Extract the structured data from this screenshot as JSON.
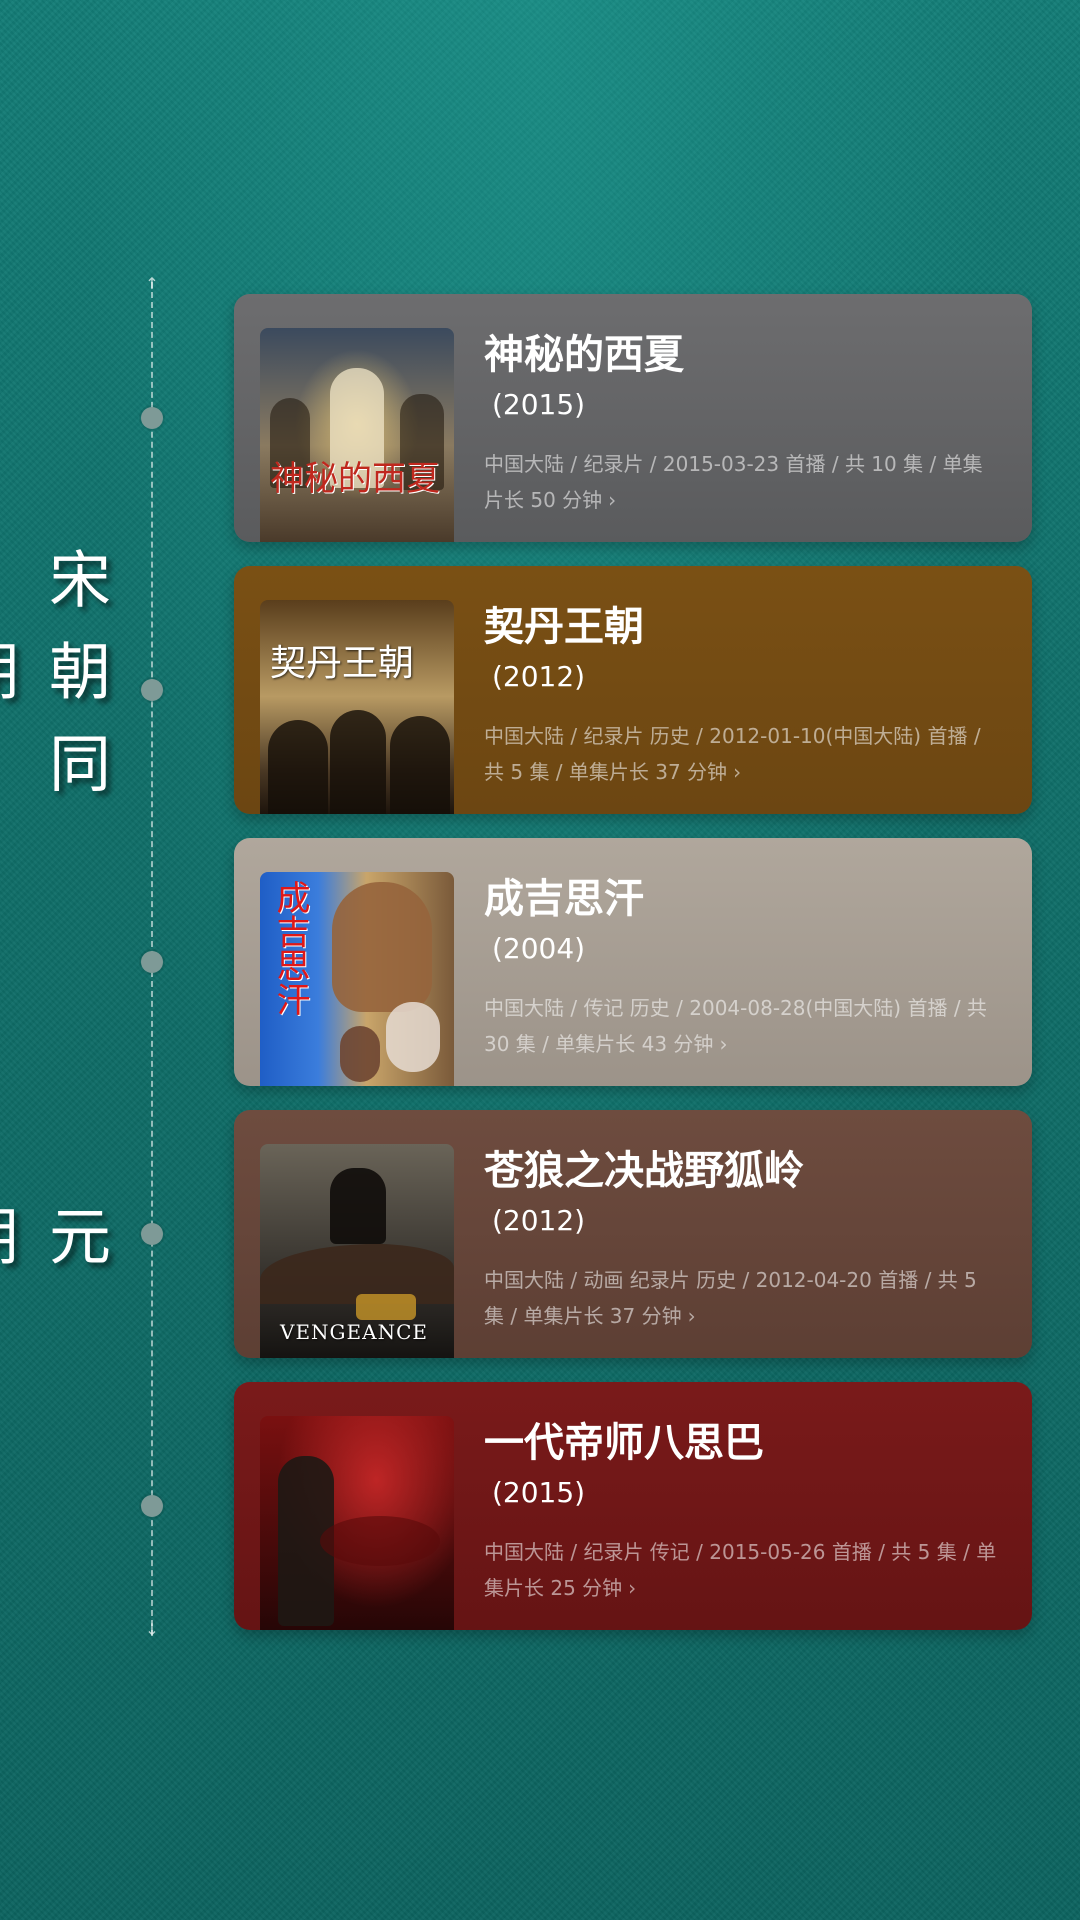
{
  "eras": [
    {
      "label": "宋朝同期"
    },
    {
      "label": "元朝"
    }
  ],
  "cards": [
    {
      "title": "神秘的西夏",
      "year": "(2015)",
      "meta": "中国大陆 / 纪录片 / 2015-03-23 首播 / 共 10 集 / 单集片长 50 分钟",
      "poster_text": "神秘的西夏",
      "chevron": "›"
    },
    {
      "title": "契丹王朝",
      "year": "(2012)",
      "meta": "中国大陆 / 纪录片 历史 / 2012-01-10(中国大陆) 首播 / 共 5 集 / 单集片长 37 分钟",
      "poster_text": "契丹王朝",
      "chevron": "›"
    },
    {
      "title": "成吉思汗",
      "year": "(2004)",
      "meta": "中国大陆 / 传记 历史 / 2004-08-28(中国大陆) 首播 / 共 30 集 / 单集片长 43 分钟",
      "poster_text": "成吉思汗",
      "chevron": "›"
    },
    {
      "title": "苍狼之决战野狐岭",
      "year": "(2012)",
      "meta": "中国大陆 / 动画 纪录片 历史 / 2012-04-20 首播 / 共 5 集 / 单集片长 37 分钟",
      "poster_text": "VENGEANCE",
      "chevron": "›"
    },
    {
      "title": "一代帝师八思巴",
      "year": "(2015)",
      "meta": "中国大陆 / 纪录片 传记 / 2015-05-26 首播 / 共 5 集 / 单集片长 25 分钟",
      "chevron": "›"
    }
  ],
  "timeline": {
    "arrow_up": "↑",
    "arrow_down": "↓"
  }
}
